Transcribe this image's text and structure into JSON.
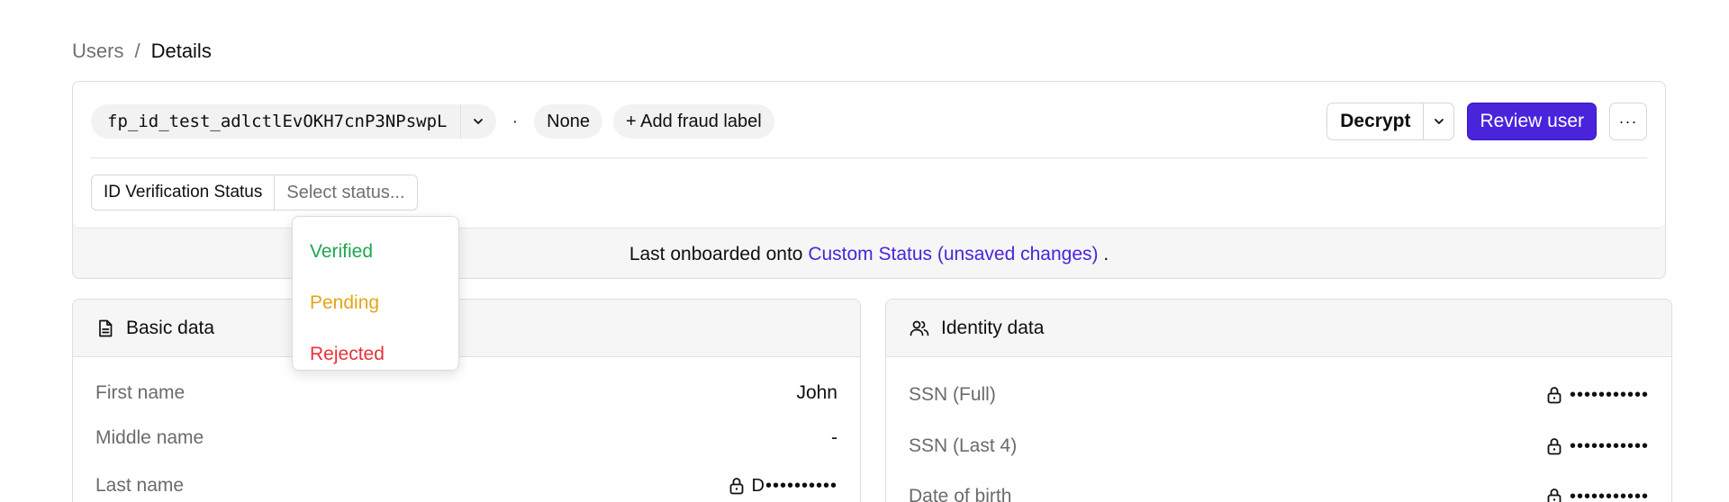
{
  "breadcrumb": {
    "parent": "Users",
    "separator": "/",
    "current": "Details"
  },
  "header": {
    "user_id": "fp_id_test_adlctlEvOKH7cnP3NPswpL",
    "dot": "·",
    "status_chip": "None",
    "add_label": "+ Add fraud label",
    "decrypt_label": "Decrypt",
    "review_label": "Review user",
    "more_label": "···"
  },
  "status_field": {
    "label": "ID Verification Status",
    "placeholder": "Select status..."
  },
  "dropdown": {
    "options": [
      "Verified",
      "Pending",
      "Rejected"
    ]
  },
  "onboard": {
    "prefix": "Last onboarded onto",
    "playbook": "Custom Status (unsaved changes)",
    "suffix": "."
  },
  "basic_data": {
    "title": "Basic data",
    "rows": [
      {
        "label": "First name",
        "value": "John"
      },
      {
        "label": "Middle name",
        "value": "-"
      },
      {
        "label": "Last name",
        "value": "D••••••••••"
      }
    ]
  },
  "identity_data": {
    "title": "Identity data",
    "rows": [
      {
        "label": "SSN (Full)",
        "value": "•••••••••••"
      },
      {
        "label": "SSN (Last 4)",
        "value": "•••••••••••"
      },
      {
        "label": "Date of birth",
        "value": "•••••••••••"
      }
    ]
  },
  "colors": {
    "accent": "#4a24db",
    "verified": "#1da74f",
    "pending": "#e6a417",
    "rejected": "#e5343a"
  },
  "icons": [
    "chevron-down-icon",
    "document-icon",
    "users-icon",
    "lock-icon",
    "more-icon"
  ]
}
